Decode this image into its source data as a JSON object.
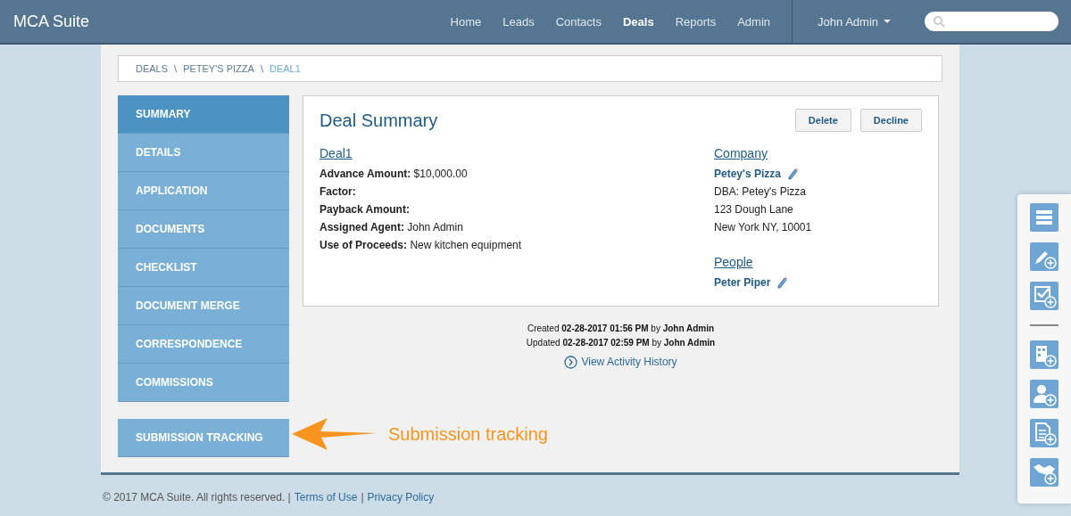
{
  "app_title": "MCA Suite",
  "nav": [
    {
      "label": "Home",
      "selected": false
    },
    {
      "label": "Leads",
      "selected": false
    },
    {
      "label": "Contacts",
      "selected": false
    },
    {
      "label": "Deals",
      "selected": true
    },
    {
      "label": "Reports",
      "selected": false
    },
    {
      "label": "Admin",
      "selected": false
    }
  ],
  "user_menu": "John Admin",
  "breadcrumb": [
    {
      "label": "DEALS",
      "selected": false
    },
    {
      "label": "PETEY'S PIZZA",
      "selected": false
    },
    {
      "label": "DEAL1",
      "selected": true
    }
  ],
  "breadcrumb_separator": "\\",
  "sidebar": {
    "items": [
      {
        "label": "SUMMARY",
        "selected": true
      },
      {
        "label": "DETAILS",
        "selected": false
      },
      {
        "label": "APPLICATION",
        "selected": false
      },
      {
        "label": "DOCUMENTS",
        "selected": false
      },
      {
        "label": "CHECKLIST",
        "selected": false
      },
      {
        "label": "DOCUMENT MERGE",
        "selected": false
      },
      {
        "label": "CORRESPONDENCE",
        "selected": false
      },
      {
        "label": "COMMISSIONS",
        "selected": false
      }
    ],
    "extra_items": [
      {
        "label": "SUBMISSION TRACKING",
        "selected": false
      }
    ]
  },
  "callout": "Submission tracking",
  "summary": {
    "title": "Deal Summary",
    "buttons": [
      "Delete",
      "Decline"
    ],
    "deal_link": "Deal1",
    "fields": [
      {
        "label": "Advance Amount:",
        "value": "$10,000.00"
      },
      {
        "label": "Factor:"
      },
      {
        "label": "Payback Amount:"
      },
      {
        "label": "Assigned Agent:",
        "value": "John Admin"
      },
      {
        "label": "Use of Proceeds:",
        "value": "New kitchen equipment"
      }
    ],
    "company_heading": "Company",
    "company_name": "Petey's Pizza",
    "company_lines": [
      "DBA: Petey's Pizza",
      "123 Dough Lane",
      "New York NY, 10001"
    ],
    "people_heading": "People",
    "people": [
      "Peter Piper"
    ]
  },
  "meta": [
    {
      "prefix": "Created",
      "date": "02-28-2017 01:56 PM",
      "by": "by",
      "user": "John Admin"
    },
    {
      "prefix": "Updated",
      "date": "02-28-2017 02:59 PM",
      "by": "by",
      "user": "John Admin"
    }
  ],
  "activity_link": "View Activity History",
  "footer": {
    "copyright": "© 2017 MCA Suite. All rights reserved. |",
    "links": [
      "Terms of Use",
      "Privacy Policy"
    ],
    "separator": "|"
  }
}
